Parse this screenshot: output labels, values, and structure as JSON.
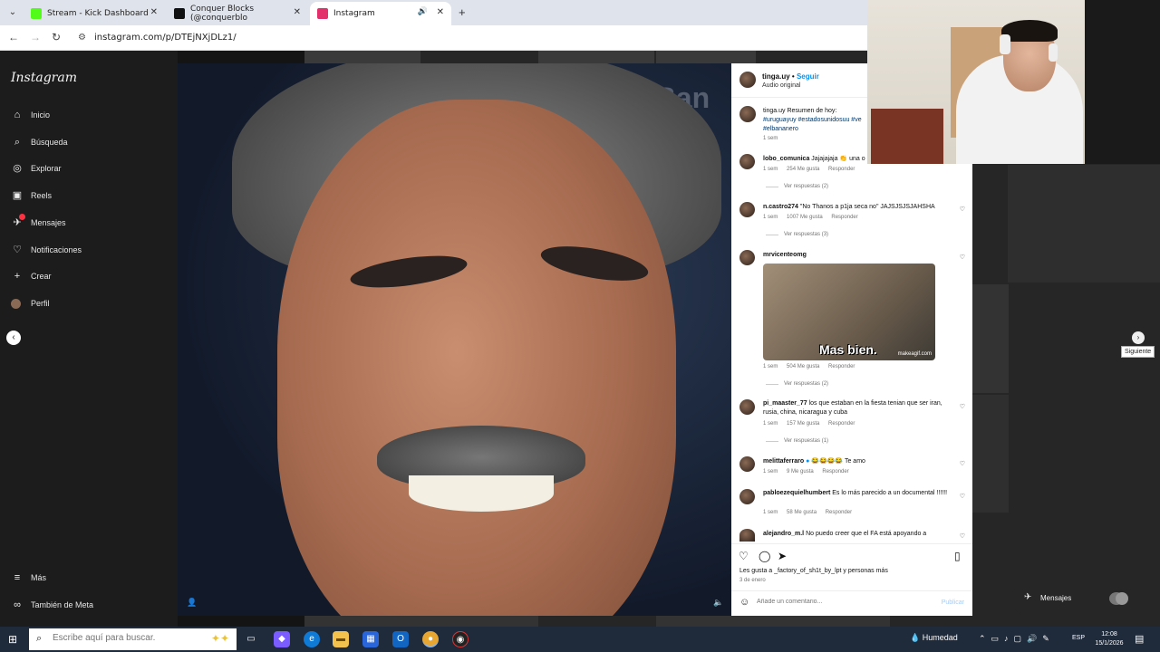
{
  "browser": {
    "tabs": [
      {
        "title": "Stream - Kick Dashboard",
        "color": "#53fc18"
      },
      {
        "title": "Conquer Blocks (@conquerblo",
        "color": "#111111"
      },
      {
        "title": "Instagram",
        "color": "#e1306c"
      }
    ],
    "url": "instagram.com/p/DTEjNXjDLz1/"
  },
  "sidebar": {
    "logo": "Instagram",
    "items": [
      {
        "label": "Inicio",
        "icon": "home-icon"
      },
      {
        "label": "Búsqueda",
        "icon": "search-icon"
      },
      {
        "label": "Explorar",
        "icon": "compass-icon"
      },
      {
        "label": "Reels",
        "icon": "reels-icon"
      },
      {
        "label": "Mensajes",
        "icon": "messenger-icon"
      },
      {
        "label": "Notificaciones",
        "icon": "heart-icon"
      },
      {
        "label": "Crear",
        "icon": "plus-icon"
      },
      {
        "label": "Perfil",
        "icon": "avatar"
      }
    ],
    "more": "Más",
    "meta": "También de Meta"
  },
  "post": {
    "username": "tinga.uy",
    "follow": "Seguir",
    "audio": "Audio original",
    "caption_user": "tinga.uy",
    "caption_text": "Resumen de hoy:",
    "caption_tags_1": "#uruguayuy #estadosunidosuu #ve",
    "caption_tags_2": "#elbananero",
    "caption_time": "1 sem",
    "comments": [
      {
        "user": "lobo_comunica",
        "text": "Jajajajaja 👏 una o",
        "time": "1 sem",
        "likes": "254 Me gusta",
        "reply": "Responder",
        "replies": "Ver respuestas (2)"
      },
      {
        "user": "n.castro274",
        "text": "\"No Thanos a p1ja seca no\" JAJSJSJSJAHSHA",
        "time": "1 sem",
        "likes": "1007 Me gusta",
        "reply": "Responder",
        "replies": "Ver respuestas (3)"
      },
      {
        "user": "mrvicenteomg",
        "text": "",
        "time": "1 sem",
        "likes": "504 Me gusta",
        "reply": "Responder",
        "replies": "Ver respuestas (2)",
        "gif_text": "Mas bien.",
        "gif_mark": "makeagif.com"
      },
      {
        "user": "pi_maaster_77",
        "text": "los que estaban en la fiesta tenian que ser iran, rusia, china, nicaragua y cuba",
        "time": "1 sem",
        "likes": "157 Me gusta",
        "reply": "Responder",
        "replies": "Ver respuestas (1)"
      },
      {
        "user": "melittaferraro",
        "text": "😂😂😂😂 Te amo",
        "time": "1 sem",
        "likes": "9 Me gusta",
        "reply": "Responder"
      },
      {
        "user": "pabloezequielhumbert",
        "text": "Es lo más parecido a un documental !!!!!!",
        "time": "1 sem",
        "likes": "58 Me gusta",
        "reply": "Responder"
      },
      {
        "user": "alejandro_m.l",
        "text": "No puedo creer que el FA está apoyando a"
      }
    ],
    "liked_by": "Les gusta a _factory_of_sh1t_by_lpt y personas más",
    "date": "3 de enero",
    "comment_placeholder": "Añade un comentario...",
    "publish": "Publicar"
  },
  "overlay": {
    "next_tooltip": "Siguiente",
    "messages": "Mensajes",
    "photo_bg_text": "elBan"
  },
  "taskbar": {
    "search_placeholder": "Escribe aquí para buscar.",
    "weather": "Humedad",
    "lang": "ESP",
    "time": "12:08",
    "date": "15/1/2026"
  }
}
